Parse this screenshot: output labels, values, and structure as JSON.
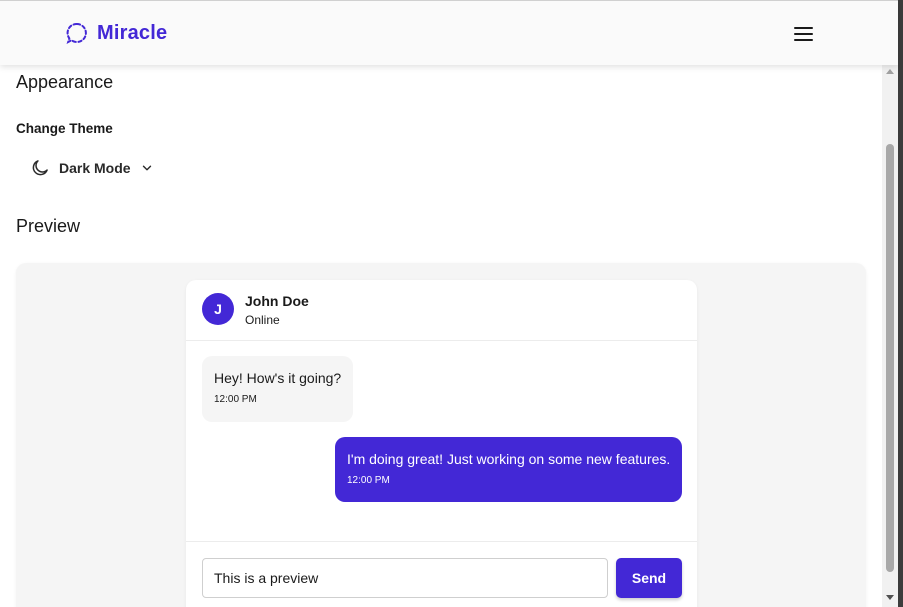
{
  "header": {
    "brand": "Miracle",
    "brand_icon": "dashed-chat-bubble-icon",
    "menu_icon": "hamburger-menu-icon"
  },
  "appearance": {
    "title": "Appearance",
    "change_theme_label": "Change Theme",
    "theme_selected": "Dark Mode",
    "theme_icon": "moon-icon"
  },
  "preview": {
    "title": "Preview",
    "contact": {
      "initial": "J",
      "name": "John Doe",
      "status": "Online"
    },
    "messages": [
      {
        "direction": "incoming",
        "text": "Hey! How's it going?",
        "time": "12:00 PM"
      },
      {
        "direction": "outgoing",
        "text": "I'm doing great! Just working on some new features.",
        "time": "12:00 PM"
      }
    ],
    "input_value": "This is a preview",
    "send_label": "Send"
  },
  "colors": {
    "accent": "#4328d6",
    "header_bg": "#fafafa",
    "panel_bg": "#f5f5f5",
    "incoming_bubble": "#f5f5f5",
    "outgoing_bubble": "#4328d6"
  }
}
